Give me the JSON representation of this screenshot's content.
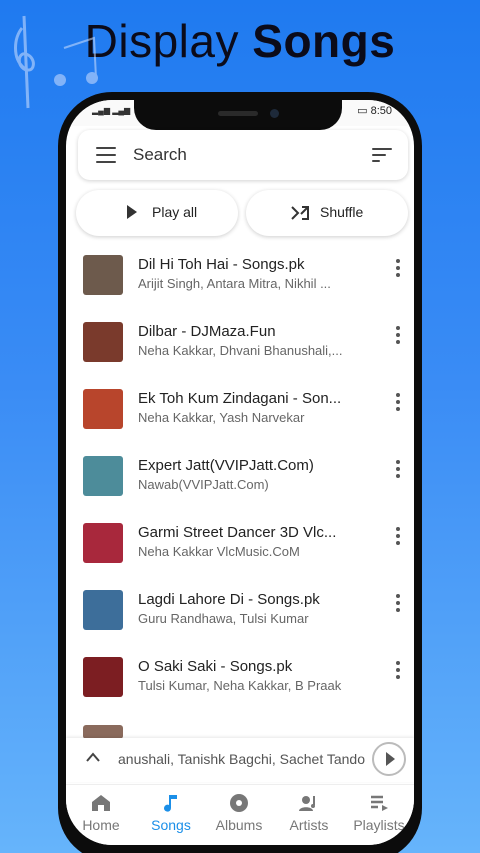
{
  "promo": {
    "title_light": "Display ",
    "title_bold": "Songs"
  },
  "status": {
    "time": "8:50"
  },
  "search": {
    "label": "Search"
  },
  "actions": {
    "play_all": "Play all",
    "shuffle": "Shuffle"
  },
  "songs": [
    {
      "title": "Dil Hi Toh Hai - Songs.pk",
      "artist": "Arijit Singh, Antara Mitra, Nikhil ...",
      "thumb_color": "#6d5a4c"
    },
    {
      "title": "Dilbar - DJMaza.Fun",
      "artist": "Neha Kakkar, Dhvani Bhanushali,...",
      "thumb_color": "#7a3a2c"
    },
    {
      "title": "Ek Toh Kum Zindagani - Son...",
      "artist": "Neha Kakkar, Yash Narvekar",
      "thumb_color": "#b8452c"
    },
    {
      "title": "Expert Jatt(VVIPJatt.Com)",
      "artist": "Nawab(VVIPJatt.Com)",
      "thumb_color": "#4d8c9a"
    },
    {
      "title": "Garmi Street Dancer 3D Vlc...",
      "artist": "Neha Kakkar VlcMusic.CoM",
      "thumb_color": "#a8283c"
    },
    {
      "title": "Lagdi Lahore Di - Songs.pk",
      "artist": "Guru Randhawa, Tulsi Kumar",
      "thumb_color": "#3d6e9a"
    },
    {
      "title": "O Saki Saki - Songs.pk",
      "artist": "Tulsi Kumar, Neha Kakkar, B Praak",
      "thumb_color": "#7c1e22"
    }
  ],
  "mini_player": {
    "text": "anushali, Tanishk Bagchi, Sachet Tando"
  },
  "nav": [
    {
      "label": "Home",
      "icon": "home-icon"
    },
    {
      "label": "Songs",
      "icon": "music-note-icon"
    },
    {
      "label": "Albums",
      "icon": "album-icon"
    },
    {
      "label": "Artists",
      "icon": "artists-icon"
    },
    {
      "label": "Playlists",
      "icon": "playlist-icon"
    }
  ],
  "colors": {
    "accent": "#1b8fe8",
    "background_top": "#1f7af0",
    "background_bottom": "#66b4fb"
  }
}
